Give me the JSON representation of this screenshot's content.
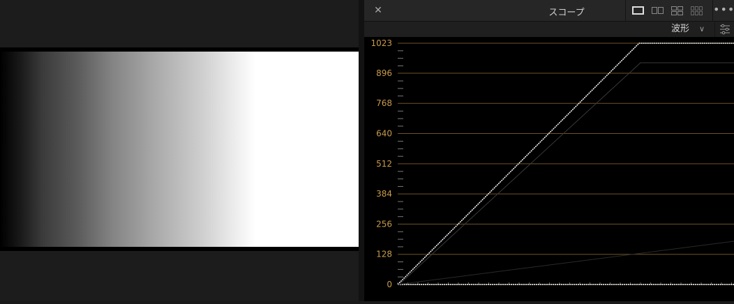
{
  "scope": {
    "title": "スコープ",
    "mode": "波形",
    "y_ticks": [
      "1023",
      "896",
      "768",
      "640",
      "512",
      "384",
      "256",
      "128",
      "0"
    ],
    "colors": {
      "tick_label": "#c89b4a",
      "grid_line": "#6e5426",
      "trace": "#ffffff",
      "background": "#000000"
    }
  },
  "icons": {
    "close": "close-icon",
    "layout_single": "layout-single-icon",
    "layout_two": "layout-two-icon",
    "layout_quad": "layout-quad-icon",
    "layout_multi": "layout-multi-icon",
    "more": "more-icon",
    "mode_chevron": "chevron-down-icon",
    "settings": "settings-sliders-icon"
  }
}
